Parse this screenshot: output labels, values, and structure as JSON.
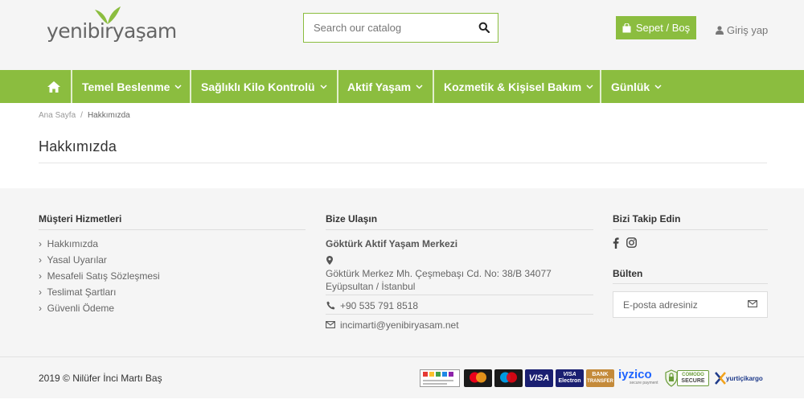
{
  "header": {
    "logo": {
      "text": "yenibiryaşam"
    },
    "search": {
      "placeholder": "Search our catalog"
    },
    "cart": {
      "label": "Sepet / Boş"
    },
    "login": {
      "label": "Giriş yap"
    }
  },
  "nav": {
    "items": [
      {
        "label": "Temel Beslenme"
      },
      {
        "label": "Sağlıklı Kilo Kontrolü"
      },
      {
        "label": "Aktif Yaşam"
      },
      {
        "label": "Kozmetik & Kişisel Bakım"
      },
      {
        "label": "Günlük"
      }
    ]
  },
  "breadcrumb": {
    "home": "Ana Sayfa",
    "separator": "/",
    "current": "Hakkımızda"
  },
  "page": {
    "title": "Hakkımızda"
  },
  "footer": {
    "services": {
      "heading": "Müşteri Hizmetleri",
      "links": [
        "Hakkımızda",
        "Yasal Uyarılar",
        "Mesafeli Satış Sözleşmesi",
        "Teslimat Şartları",
        "Güvenli Ödeme"
      ]
    },
    "contact": {
      "heading": "Bize Ulaşın",
      "name": "Göktürk Aktif Yaşam Merkezi",
      "address_line1": "Göktürk Merkez Mh. Çeşmebaşı Cd. No: 38/B 34077",
      "address_line2": "Eyüpsultan / İstanbul",
      "phone": "+90 535 791 8518",
      "email": "incimarti@yenibiryasam.net"
    },
    "social": {
      "heading": "Bizi Takip Edin"
    },
    "newsletter": {
      "heading": "Bülten",
      "placeholder": "E-posta adresiniz"
    }
  },
  "bottom": {
    "copyright": "2019 © Nilüfer İnci Martı Baş",
    "payments": {
      "visa": "VISA",
      "visa_electron_top": "VISA",
      "visa_electron_bottom": "Electron",
      "bank_top": "BANK",
      "bank_bottom": "TRANSFER",
      "iyzico": "iyzico",
      "iyzico_sub": "secure payment",
      "comodo_top": "COMODO",
      "comodo_bottom": "SECURE",
      "yurtici": "yurtiçikargo"
    }
  },
  "colors": {
    "brand_green": "#8bbd3f",
    "footer_bg": "#f5f5f5"
  }
}
